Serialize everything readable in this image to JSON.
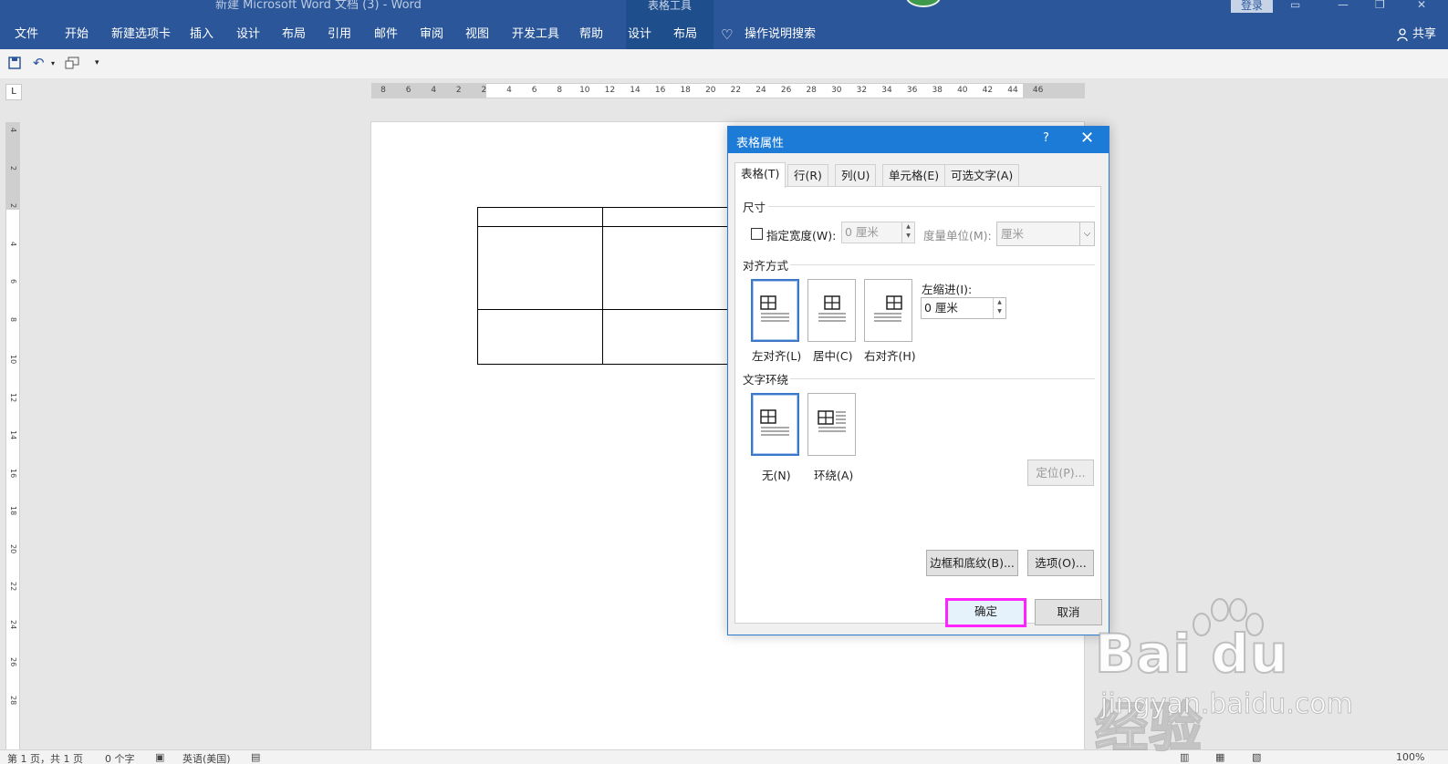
{
  "titlebar": {
    "doc_title": "新建 Microsoft Word 文档 (3)  -  Word",
    "context_title": "表格工具",
    "login": "登录"
  },
  "menu": {
    "items": [
      "文件",
      "开始",
      "新建选项卡",
      "插入",
      "设计",
      "布局",
      "引用",
      "邮件",
      "审阅",
      "视图",
      "开发工具",
      "帮助",
      "设计",
      "布局"
    ],
    "tell_me": "操作说明搜索",
    "share": "共享"
  },
  "ruler": {
    "h_ticks": [
      "8",
      "6",
      "4",
      "2",
      "2",
      "4",
      "6",
      "8",
      "10",
      "12",
      "14",
      "16",
      "18",
      "20",
      "22",
      "24",
      "26",
      "28",
      "30",
      "32",
      "34",
      "36",
      "38",
      "40",
      "42",
      "44",
      "46"
    ],
    "v_ticks": [
      "4",
      "2",
      "2",
      "4",
      "6",
      "8",
      "10",
      "12",
      "14",
      "16",
      "18",
      "20",
      "22",
      "24",
      "26",
      "28"
    ]
  },
  "dialog": {
    "title": "表格属性",
    "help": "?",
    "close": "✕",
    "tabs": [
      "表格(T)",
      "行(R)",
      "列(U)",
      "单元格(E)",
      "可选文字(A)"
    ],
    "size": {
      "section": "尺寸",
      "width_checkbox_label": "指定宽度(W):",
      "width_value": "0 厘米",
      "unit_label": "度量单位(M):",
      "unit_value": "厘米"
    },
    "alignment": {
      "section": "对齐方式",
      "options": [
        "左对齐(L)",
        "居中(C)",
        "右对齐(H)"
      ],
      "indent_label": "左缩进(I):",
      "indent_value": "0 厘米"
    },
    "wrapping": {
      "section": "文字环绕",
      "options": [
        "无(N)",
        "环绕(A)"
      ],
      "position_button": "定位(P)..."
    },
    "borders_button": "边框和底纹(B)...",
    "options_button": "选项(O)...",
    "ok": "确定",
    "cancel": "取消"
  },
  "statusbar": {
    "page": "第 1 页，共 1 页",
    "words": "0 个字",
    "language": "英语(美国)",
    "zoom": "100%"
  },
  "watermark": {
    "brand": "Bai du 经验",
    "url": "jingyan.baidu.com"
  },
  "colors": {
    "ribbon": "#2b579a",
    "dialog_title": "#1c7bd6",
    "highlight": "#ff24ff"
  }
}
